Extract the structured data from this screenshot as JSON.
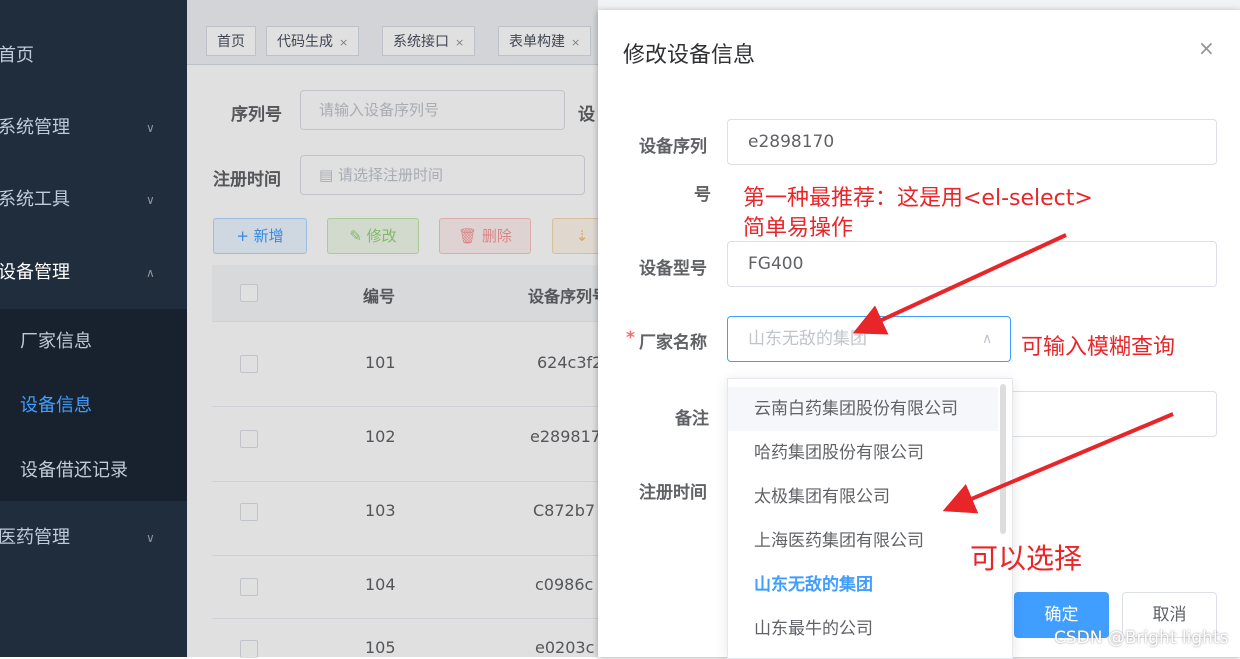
{
  "sidebar": {
    "items": [
      {
        "label": "首页"
      },
      {
        "label": "系统管理"
      },
      {
        "label": "系统工具"
      },
      {
        "label": "设备管理"
      },
      {
        "label": "医药管理"
      }
    ],
    "subitems": [
      {
        "label": "厂家信息"
      },
      {
        "label": "设备信息"
      },
      {
        "label": "设备借还记录"
      }
    ]
  },
  "tags": [
    {
      "label": "首页"
    },
    {
      "label": "代码生成"
    },
    {
      "label": "系统接口"
    },
    {
      "label": "表单构建"
    }
  ],
  "search": {
    "serial_label": "序列号",
    "serial_placeholder": "请输入设备序列号",
    "model_label_partial": "设",
    "regtime_label": "注册时间",
    "regtime_placeholder": "请选择注册时间"
  },
  "toolbar": {
    "add": "+ 新增",
    "edit": "修改",
    "delete": "删除"
  },
  "table": {
    "headers": [
      "编号",
      "设备序列号"
    ],
    "rows": [
      {
        "id": "101",
        "serial": "624c3f2"
      },
      {
        "id": "102",
        "serial": "e289817"
      },
      {
        "id": "103",
        "serial": "C872b7"
      },
      {
        "id": "104",
        "serial": "c0986c"
      },
      {
        "id": "105",
        "serial": "e0203c"
      }
    ]
  },
  "dialog": {
    "title": "修改设备信息",
    "serial_label_line1": "设备序列",
    "serial_label_line2": "号",
    "serial_value": "e2898170",
    "model_label": "设备型号",
    "model_value": "FG400",
    "maker_label": "厂家名称",
    "maker_required": "*",
    "maker_placeholder": "山东无敌的集团",
    "remark_label": "备注",
    "regtime_label": "注册时间",
    "confirm": "确定",
    "cancel": "取消"
  },
  "dropdown": {
    "options": [
      {
        "label": "云南白药集团股份有限公司"
      },
      {
        "label": "哈药集团股份有限公司"
      },
      {
        "label": "太极集团有限公司"
      },
      {
        "label": "上海医药集团有限公司"
      },
      {
        "label": "山东无敌的集团"
      },
      {
        "label": "山东最牛的公司"
      }
    ]
  },
  "annotations": {
    "note1_line1": "第一种最推荐：这是用<el-select>",
    "note1_line2": "简单易操作",
    "note2": "可输入模糊查询",
    "note3": "可以选择"
  },
  "watermark": "CSDN @Bright lights",
  "colors": {
    "primary": "#409eff",
    "sidebar": "#1f2d3d",
    "annotation": "#e8262a"
  }
}
